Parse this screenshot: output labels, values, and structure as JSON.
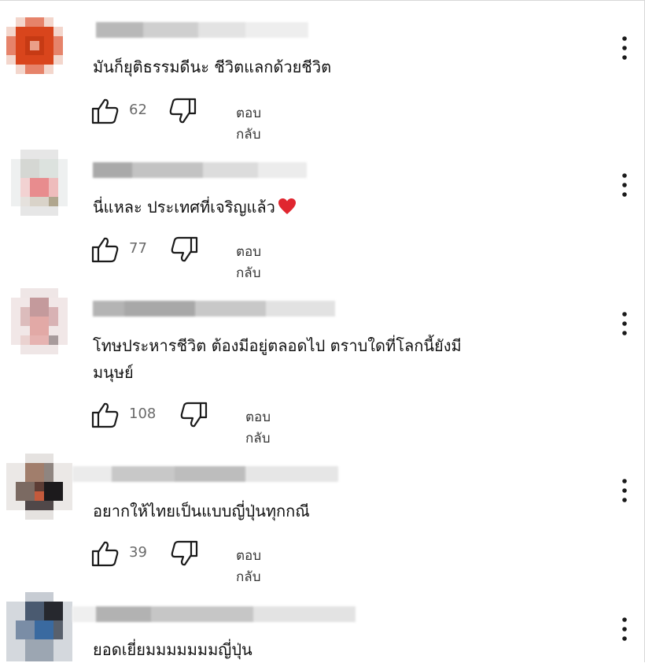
{
  "comments": [
    {
      "text": "มันก็ยุติธรรมดีนะ ชีวิตแลกด้วยชีวิต",
      "likes": "62",
      "reply_label": "ตอบกลับ"
    },
    {
      "text": "นี่แหละ ประเทศที่เจริญแล้ว",
      "likes": "77",
      "reply_label": "ตอบกลับ"
    },
    {
      "text_line1": "โทษประหารชีวิต ต้องมีอยู่ตลอดไป ตราบใดที่โลกนี้ยังมี",
      "text_line2": "มนุษย์",
      "likes": "108",
      "reply_label": "ตอบกลับ"
    },
    {
      "text": "อยากให้ไทยเป็นแบบญี่ปุ่นทุกกณี",
      "likes": "39",
      "reply_label": "ตอบกลับ"
    },
    {
      "text": "ยอดเยี่ยมมมมมมมญี่ปุ่น"
    }
  ],
  "icons": {
    "like": "thumb-up-icon",
    "dislike": "thumb-down-icon",
    "more": "more-vertical-icon",
    "heart": "heart-emoji"
  },
  "colors": {
    "heart": "#e0262f",
    "icon": "#1a1a1a",
    "count": "#6a6a6a"
  }
}
